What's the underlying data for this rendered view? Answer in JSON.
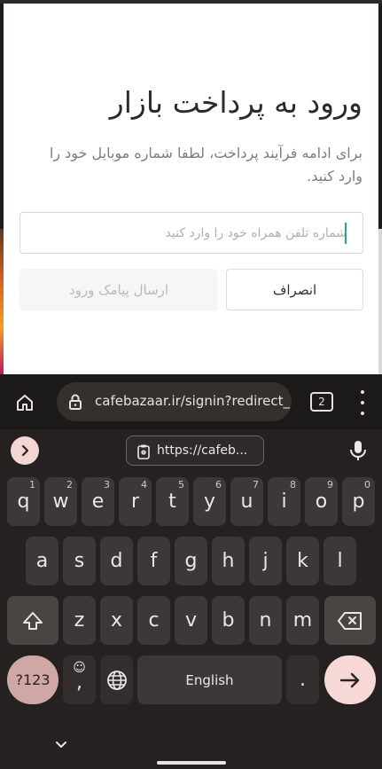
{
  "dialog": {
    "title": "ورود به پرداخت بازار",
    "description": "برای ادامه فرآیند پرداخت، لطفا شماره موبایل خود را وارد کنید.",
    "phone_placeholder": "شماره تلفن همراه خود را وارد کنید",
    "phone_value": "",
    "send_button": "ارسال پیامک ورود",
    "cancel_button": "انصراف"
  },
  "browser": {
    "url": "cafebazaar.ir/signin?redirect_u",
    "tab_count": "2",
    "icons": {
      "home": "home-icon",
      "lock": "lock-icon",
      "menu": "more-vert-icon"
    }
  },
  "keyboard": {
    "clipboard_chip": "https://cafeb...",
    "row1": [
      {
        "key": "q",
        "hint": "1"
      },
      {
        "key": "w",
        "hint": "2"
      },
      {
        "key": "e",
        "hint": "3"
      },
      {
        "key": "r",
        "hint": "4"
      },
      {
        "key": "t",
        "hint": "5"
      },
      {
        "key": "y",
        "hint": "6"
      },
      {
        "key": "u",
        "hint": "7"
      },
      {
        "key": "i",
        "hint": "8"
      },
      {
        "key": "o",
        "hint": "9"
      },
      {
        "key": "p",
        "hint": "0"
      }
    ],
    "row2": [
      "a",
      "s",
      "d",
      "f",
      "g",
      "h",
      "j",
      "k",
      "l"
    ],
    "row3": [
      "z",
      "x",
      "c",
      "v",
      "b",
      "n",
      "m"
    ],
    "symbols_key": "?123",
    "comma_key": ",",
    "emoji_hint": "☺",
    "space_label": "English",
    "period_key": ".",
    "colors": {
      "background": "#252120",
      "key": "#3d3837",
      "accent": "#f8d8d6"
    }
  }
}
